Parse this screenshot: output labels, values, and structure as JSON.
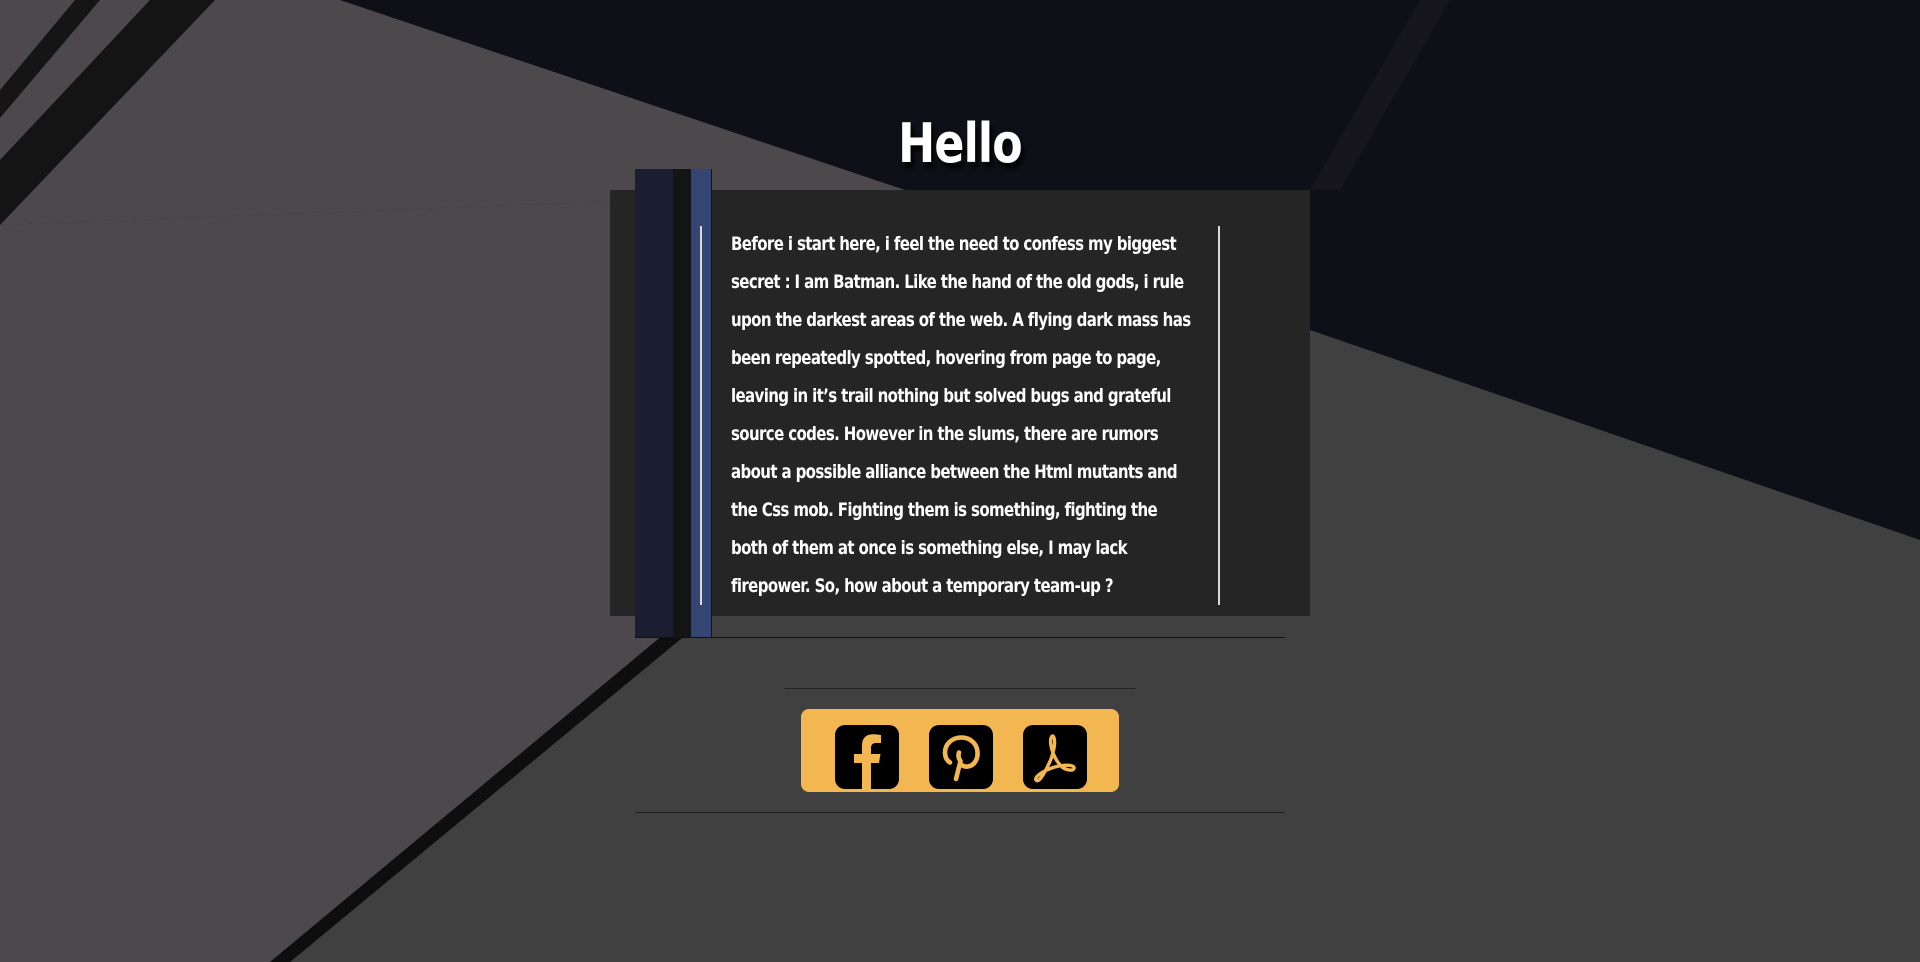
{
  "page": {
    "heading": "Hello",
    "paragraph": "Before i start here, i feel the need to confess my biggest secret : I am Batman. Like the hand of the old gods, i rule upon the darkest areas of the web. A flying dark mass has been repeatedly spotted, hovering from page to page, leaving in it’s trail nothing but solved bugs and grateful source codes. However in the slums, there are rumors about a possible alliance between the Html mutants and the Css mob. Fighting them is something, fighting the both of them at once is something else, I may lack firepower. So, how about a temporary team-up ?"
  },
  "social": {
    "links": [
      {
        "icon": "facebook-icon"
      },
      {
        "icon": "pinterest-icon"
      },
      {
        "icon": "pdf-icon"
      }
    ]
  },
  "colors": {
    "background_dark": "#0f0f18",
    "background_grey": "#404040",
    "background_mauve": "#4d484c",
    "panel": "#252525",
    "accent_navy": "#1b1e30",
    "accent_blue": "#354572",
    "social_bar": "#f3b752"
  }
}
